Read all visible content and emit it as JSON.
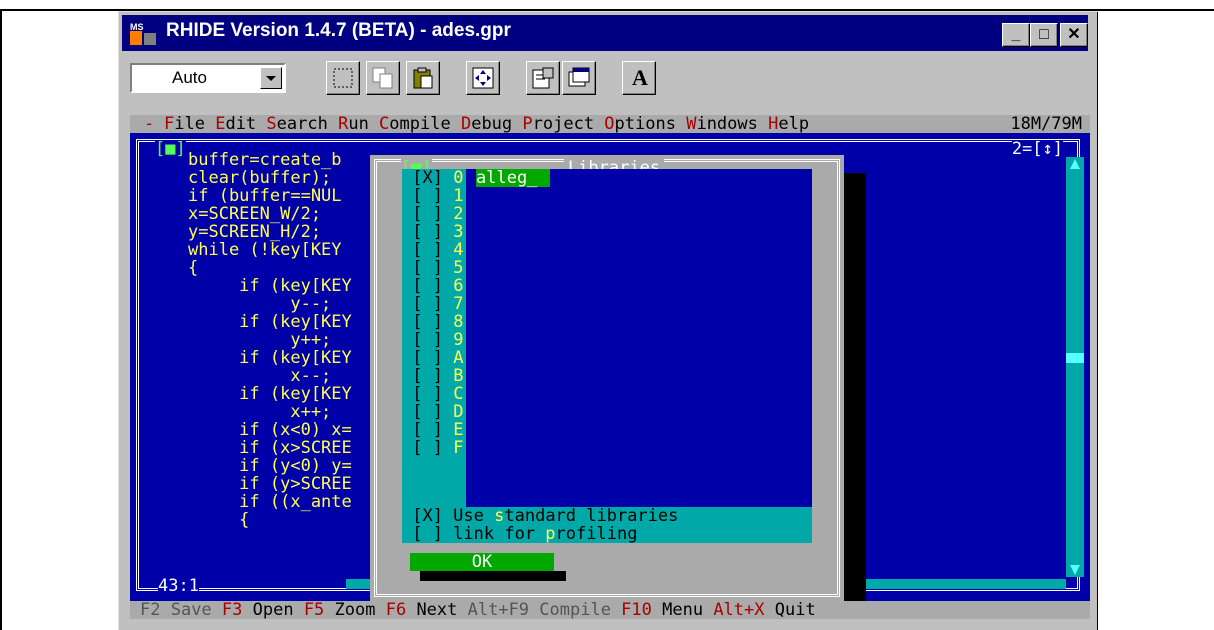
{
  "window": {
    "title": "RHIDE Version 1.4.7 (BETA) - ades.gpr"
  },
  "toolbar": {
    "font_select_value": "Auto",
    "font_letter": "A"
  },
  "menu": {
    "system": "-",
    "items": [
      {
        "hot": "F",
        "rest": "ile"
      },
      {
        "hot": "E",
        "rest": "dit"
      },
      {
        "hot": "S",
        "rest": "earch"
      },
      {
        "hot": "R",
        "rest": "un"
      },
      {
        "hot": "C",
        "rest": "ompile"
      },
      {
        "hot": "D",
        "rest": "ebug"
      },
      {
        "hot": "P",
        "rest": "roject"
      },
      {
        "hot": "O",
        "rest": "ptions"
      },
      {
        "hot": "W",
        "rest": "indows"
      },
      {
        "hot": "H",
        "rest": "elp"
      }
    ],
    "memory": "18M/79M"
  },
  "editor": {
    "close_glyph": "[■]",
    "window_number": "2=[↕]",
    "cursor_pos": "43:1",
    "lines": [
      "buffer=create_b",
      "clear(buffer);",
      "if (buffer==NUL",
      "x=SCREEN_W/2;",
      "y=SCREEN_H/2;",
      "while (!key[KEY",
      "{",
      "     if (key[KEY",
      "          y--;",
      "     if (key[KEY",
      "          y++;",
      "     if (key[KEY",
      "          x--;",
      "     if (key[KEY",
      "          x++;",
      "     if (x<0) x=",
      "     if (x>SCREE",
      "     if (y<0) y=",
      "     if (y>SCREE",
      "     if ((x_ante",
      "     {"
    ]
  },
  "dialog": {
    "title": "Libraries",
    "close_glyph": "[■]",
    "checked": "[X]",
    "unchecked": "[ ]",
    "libraries": [
      "0",
      "1",
      "2",
      "3",
      "4",
      "5",
      "6",
      "7",
      "8",
      "9",
      "A",
      "B",
      "C",
      "D",
      "E",
      "F"
    ],
    "first_library_value": "alleg_",
    "options": [
      {
        "check": "[X]",
        "pre": " Use ",
        "hot": "s",
        "post": "tandard libraries"
      },
      {
        "check": "[ ]",
        "pre": " link for ",
        "hot": "p",
        "post": "rofiling"
      }
    ],
    "ok_label": "OK"
  },
  "status": [
    {
      "key": "F2",
      "label": "Save",
      "enabled": false
    },
    {
      "key": "F3",
      "label": "Open",
      "enabled": true
    },
    {
      "key": "F5",
      "label": "Zoom",
      "enabled": true
    },
    {
      "key": "F6",
      "label": "Next",
      "enabled": true
    },
    {
      "key": "Alt+F9",
      "label": "Compile",
      "enabled": false
    },
    {
      "key": "F10",
      "label": "Menu",
      "enabled": true
    },
    {
      "key": "Alt+X",
      "label": "Quit",
      "enabled": true
    }
  ],
  "colors": {
    "dos_blue": "#0000a8",
    "dos_cyan": "#00a8a8",
    "dos_gray": "#aaaaaa",
    "dos_yellow": "#ffff55",
    "dos_green": "#00a800",
    "win_titlebar": "#000080"
  }
}
